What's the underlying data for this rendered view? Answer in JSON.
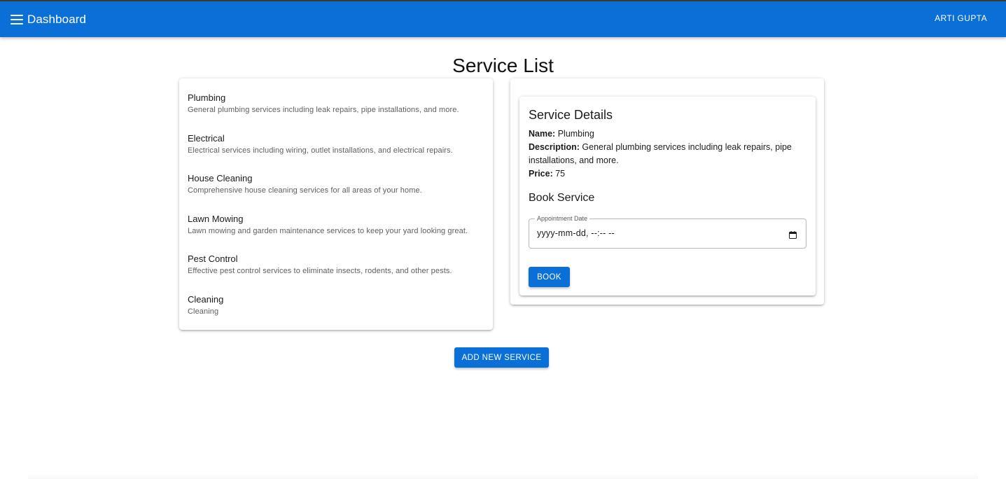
{
  "app_bar": {
    "menu_icon": "menu-icon",
    "title": "Dashboard",
    "user_name": "ARTI GUPTA",
    "color": "#0b6fd8"
  },
  "page": {
    "title": "Service List"
  },
  "services": [
    {
      "name": "Plumbing",
      "description": "General plumbing services including leak repairs, pipe installations, and more."
    },
    {
      "name": "Electrical",
      "description": "Electrical services including wiring, outlet installations, and electrical repairs."
    },
    {
      "name": "House Cleaning",
      "description": "Comprehensive house cleaning services for all areas of your home."
    },
    {
      "name": "Lawn Mowing",
      "description": "Lawn mowing and garden maintenance services to keep your yard looking great."
    },
    {
      "name": "Pest Control",
      "description": "Effective pest control services to eliminate insects, rodents, and other pests."
    },
    {
      "name": "Cleaning",
      "description": "Cleaning"
    }
  ],
  "details": {
    "heading": "Service Details",
    "name_label": "Name:",
    "name_value": "Plumbing",
    "description_label": "Description:",
    "description_value": "General plumbing services including leak repairs, pipe installations, and more.",
    "price_label": "Price:",
    "price_value": "75"
  },
  "booking": {
    "heading": "Book Service",
    "date_label": "Appointment Date",
    "date_value": "yyyy-mm-dd, --:-- --",
    "calendar_icon": "calendar-icon",
    "book_button": "Book"
  },
  "actions": {
    "add_service_button": "Add New Service"
  }
}
